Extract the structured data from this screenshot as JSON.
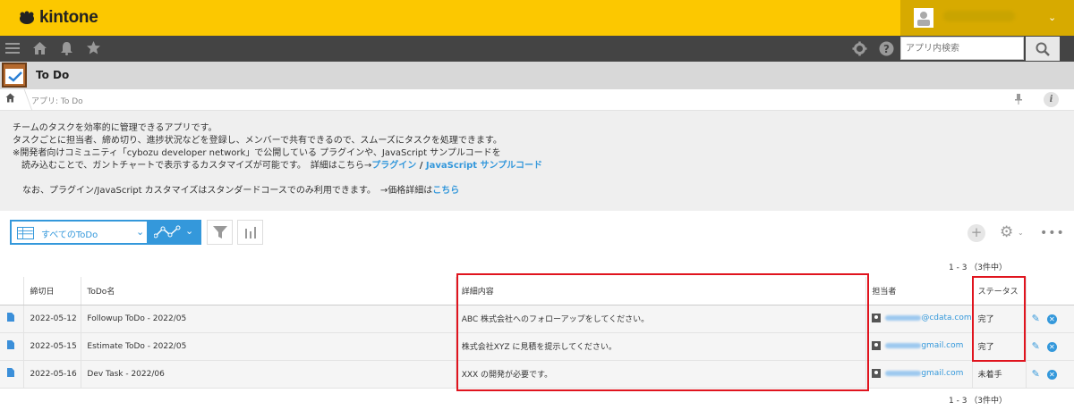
{
  "brand": {
    "name": "kintone"
  },
  "header": {
    "username": ""
  },
  "search": {
    "placeholder": "アプリ内検索"
  },
  "app": {
    "title": "To Do"
  },
  "breadcrumb": {
    "text": "アプリ: To Do"
  },
  "description": {
    "line1": "チームのタスクを効率的に管理できるアプリです。",
    "line2": "タスクごとに担当者、締め切り、進捗状況などを登録し、メンバーで共有できるので、スムーズにタスクを処理できます。",
    "line3": "※開発者向けコミュニティ「cybozu developer network」で公開している プラグインや、JavaScript サンプルコードを",
    "line4_prefix": "読み込むことで、ガントチャートで表示するカスタマイズが可能です。　詳細はこちら→",
    "link_plugin": "プラグイン",
    "slash": " / ",
    "link_js": "JavaScript サンプルコード",
    "line5_prefix": "なお、プラグイン/JavaScript カスタマイズはスタンダードコースでのみ利用できます。　→価格詳細は",
    "link_price": "こちら"
  },
  "toolbar": {
    "view_label": "すべてのToDo"
  },
  "pager": {
    "top": "1 - 3 （3件中）",
    "bottom": "1 - 3 （3件中）"
  },
  "table": {
    "headers": [
      "締切日",
      "ToDo名",
      "詳細内容",
      "担当者",
      "ステータス"
    ],
    "rows": [
      {
        "due": "2022-05-12",
        "name": "Followup ToDo - 2022/05",
        "detail": "ABC 株式会社へのフォローアップをしてください。",
        "email_domain": "@cdata.com",
        "status": "完了"
      },
      {
        "due": "2022-05-15",
        "name": "Estimate ToDo - 2022/05",
        "detail": "株式会社XYZ に見積を提示してください。",
        "email_domain": "gmail.com",
        "status": "完了"
      },
      {
        "due": "2022-05-16",
        "name": "Dev Task - 2022/06",
        "detail": "XXX の開発が必要です。",
        "email_domain": "gmail.com",
        "status": "未着手"
      }
    ]
  },
  "colors": {
    "header_yellow": "#fcc800",
    "nav_dark": "#444444",
    "accent_blue": "#3498db",
    "highlight_red": "#e0141e"
  }
}
